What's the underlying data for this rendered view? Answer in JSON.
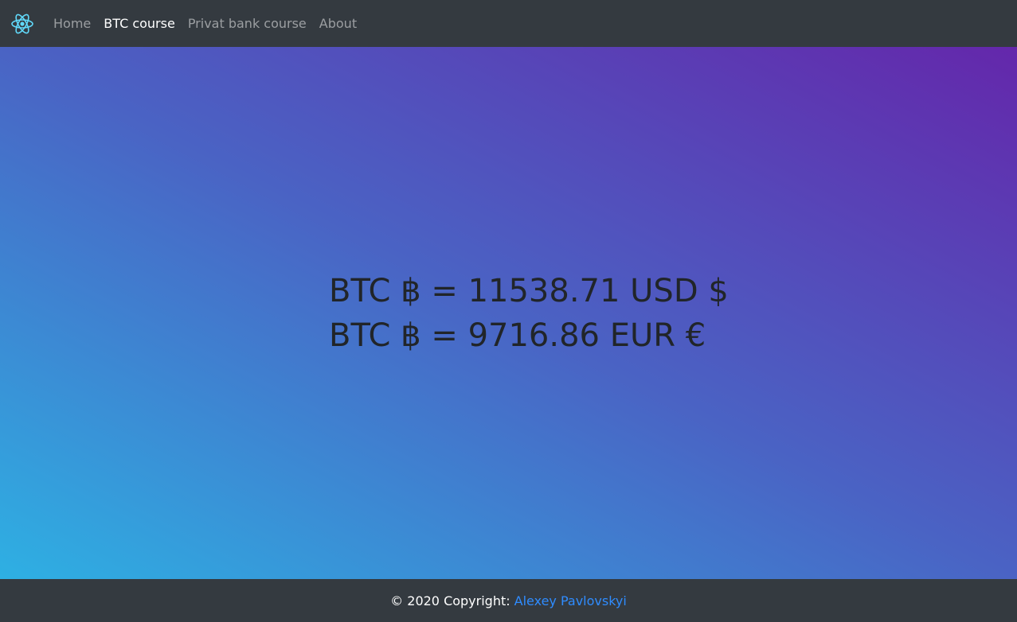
{
  "nav": {
    "logo_icon": "react-atom-icon",
    "items": [
      {
        "label": "Home",
        "active": false
      },
      {
        "label": "BTC course",
        "active": true
      },
      {
        "label": "Privat bank course",
        "active": false
      },
      {
        "label": "About",
        "active": false
      }
    ]
  },
  "rates": {
    "usd_line": "BTC ฿ = 11538.71 USD $",
    "eur_line": "BTC ฿ = 9716.86 EUR €"
  },
  "footer": {
    "prefix": "© 2020 Copyright:",
    "author": "Alexey Pavlovskyi"
  },
  "colors": {
    "nav_bg": "#343a40",
    "gradient_start": "#2eb0e3",
    "gradient_end": "#6427ab",
    "link": "#2f8cff"
  }
}
